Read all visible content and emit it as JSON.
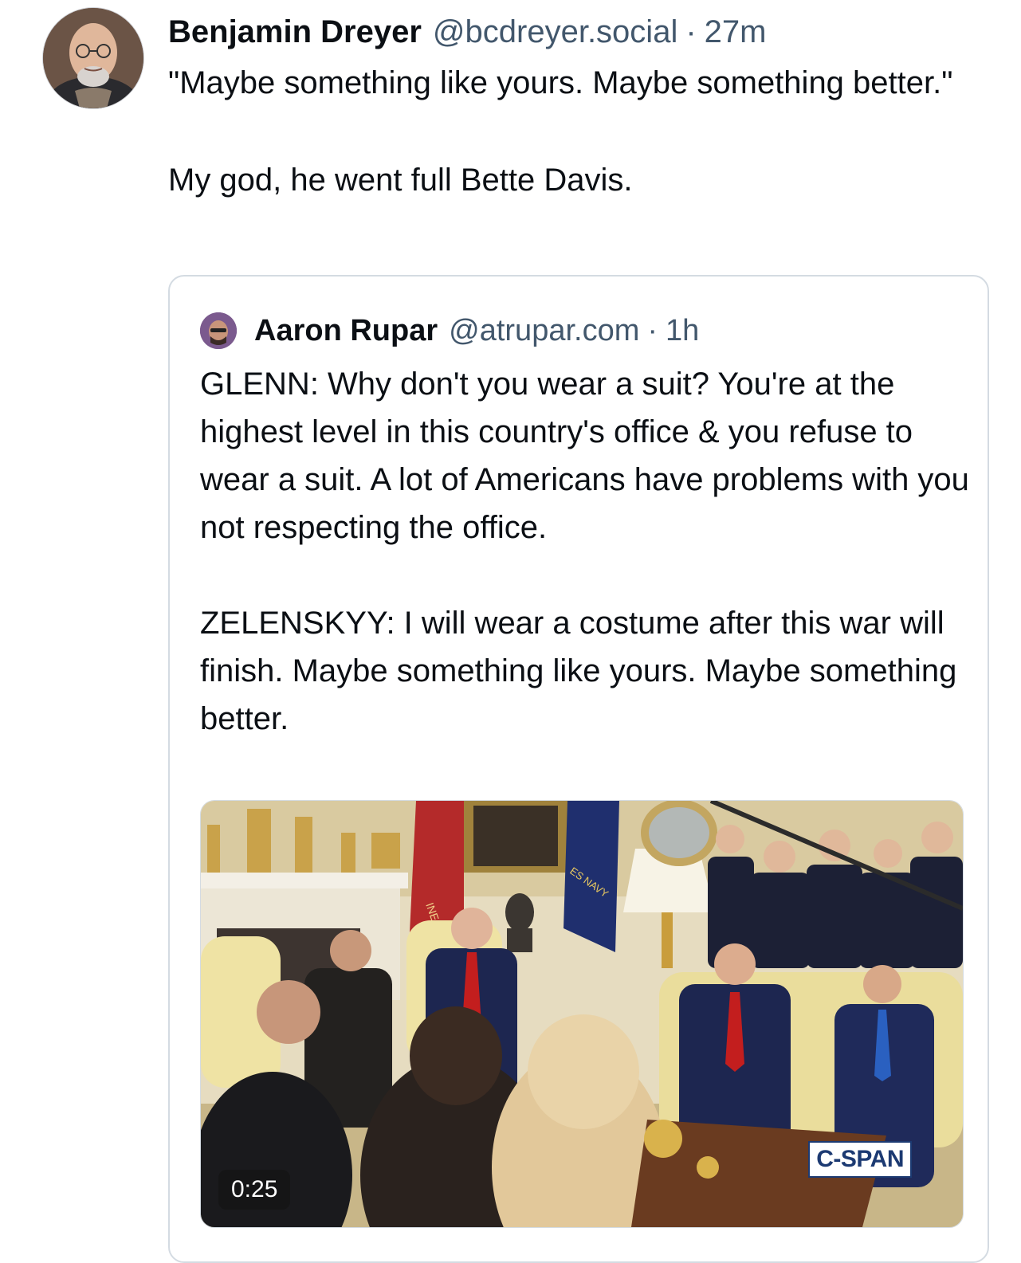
{
  "post": {
    "author_name": "Benjamin Dreyer",
    "author_handle": "@bcdreyer.social",
    "separator": "·",
    "time": "27m",
    "paragraphs": [
      "\"Maybe something like yours. Maybe something better.\"",
      "My god, he went full Bette Davis."
    ]
  },
  "quoted_post": {
    "author_name": "Aaron Rupar",
    "author_handle": "@atrupar.com",
    "separator": "·",
    "time": "1h",
    "paragraphs": [
      "GLENN: Why don't you wear a suit? You're at the highest level in this country's office & you refuse to wear a suit. A lot of Americans have problems with you not respecting the office.",
      "ZELENSKYY: I will wear a costume after this war will finish. Maybe something like yours. Maybe something better."
    ],
    "video": {
      "duration": "0:25",
      "watermark": "C-SPAN",
      "flag_text_left": "INE COR",
      "flag_text_right": "ES NAVY"
    }
  },
  "icons": {
    "avatar": "profile-photo",
    "quoted_avatar": "profile-photo",
    "video_thumbnail": "video-thumbnail"
  }
}
